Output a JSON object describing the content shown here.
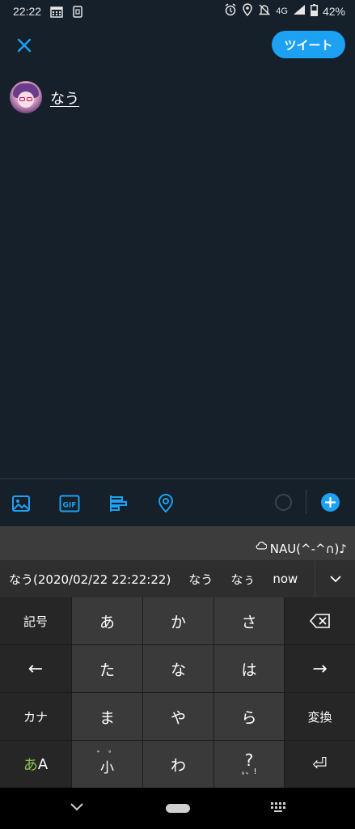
{
  "status_bar": {
    "time": "22:22",
    "network": "4G",
    "battery": "42%",
    "icons": [
      "calendar-icon",
      "sim-icon",
      "alarm-icon",
      "location-icon",
      "mute-icon",
      "signal-icon",
      "battery-icon"
    ]
  },
  "compose": {
    "tweet_button": "ツイート",
    "text": "なう"
  },
  "toolbar": {
    "icons": [
      "image-icon",
      "gif-icon",
      "poll-icon",
      "location-icon",
      "char-count-icon",
      "add-icon"
    ]
  },
  "keyboard": {
    "kaomoji": "NAU(^-^∩)♪",
    "suggestions": [
      "なう(2020/02/22 22:22:22)",
      "なう",
      "なぅ",
      "now"
    ],
    "keys": {
      "symbols": "記号",
      "a": "あ",
      "ka": "か",
      "sa": "さ",
      "left": "←",
      "ta": "た",
      "na": "な",
      "ha": "は",
      "right": "→",
      "kana": "カナ",
      "ma": "ま",
      "ya": "や",
      "ra": "ら",
      "convert": "変換",
      "mode_a": "あ",
      "mode_b": "A",
      "small_top": "゛ ゜",
      "small": "小",
      "wa": "わ",
      "punct_top": "?",
      "punct_bottom": "。、!",
      "enter": "⏎"
    }
  },
  "colors": {
    "background": "#15202b",
    "accent": "#1da1f2"
  }
}
